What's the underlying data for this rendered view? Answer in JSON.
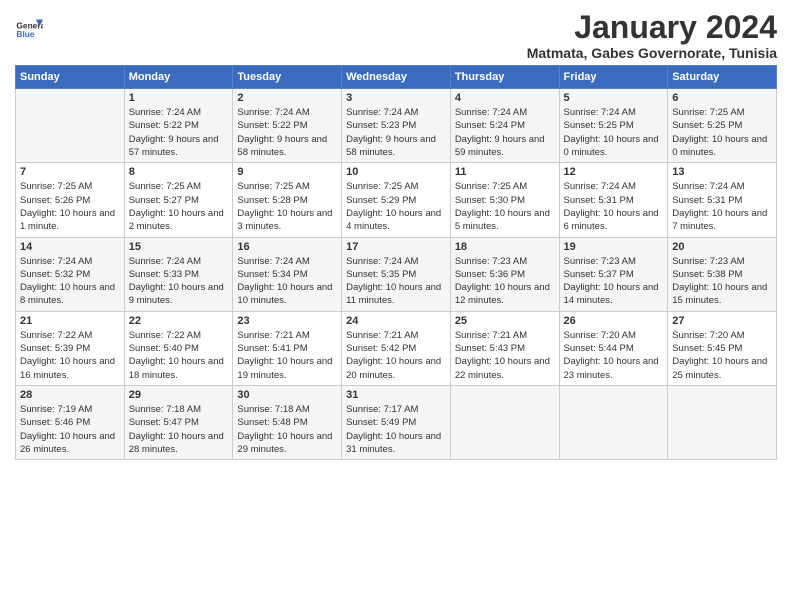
{
  "header": {
    "logo_general": "General",
    "logo_blue": "Blue",
    "title": "January 2024",
    "subtitle": "Matmata, Gabes Governorate, Tunisia"
  },
  "days_of_week": [
    "Sunday",
    "Monday",
    "Tuesday",
    "Wednesday",
    "Thursday",
    "Friday",
    "Saturday"
  ],
  "weeks": [
    [
      {
        "day": "",
        "sunrise": "",
        "sunset": "",
        "daylight": ""
      },
      {
        "day": "1",
        "sunrise": "Sunrise: 7:24 AM",
        "sunset": "Sunset: 5:22 PM",
        "daylight": "Daylight: 9 hours and 57 minutes."
      },
      {
        "day": "2",
        "sunrise": "Sunrise: 7:24 AM",
        "sunset": "Sunset: 5:22 PM",
        "daylight": "Daylight: 9 hours and 58 minutes."
      },
      {
        "day": "3",
        "sunrise": "Sunrise: 7:24 AM",
        "sunset": "Sunset: 5:23 PM",
        "daylight": "Daylight: 9 hours and 58 minutes."
      },
      {
        "day": "4",
        "sunrise": "Sunrise: 7:24 AM",
        "sunset": "Sunset: 5:24 PM",
        "daylight": "Daylight: 9 hours and 59 minutes."
      },
      {
        "day": "5",
        "sunrise": "Sunrise: 7:24 AM",
        "sunset": "Sunset: 5:25 PM",
        "daylight": "Daylight: 10 hours and 0 minutes."
      },
      {
        "day": "6",
        "sunrise": "Sunrise: 7:25 AM",
        "sunset": "Sunset: 5:25 PM",
        "daylight": "Daylight: 10 hours and 0 minutes."
      }
    ],
    [
      {
        "day": "7",
        "sunrise": "Sunrise: 7:25 AM",
        "sunset": "Sunset: 5:26 PM",
        "daylight": "Daylight: 10 hours and 1 minute."
      },
      {
        "day": "8",
        "sunrise": "Sunrise: 7:25 AM",
        "sunset": "Sunset: 5:27 PM",
        "daylight": "Daylight: 10 hours and 2 minutes."
      },
      {
        "day": "9",
        "sunrise": "Sunrise: 7:25 AM",
        "sunset": "Sunset: 5:28 PM",
        "daylight": "Daylight: 10 hours and 3 minutes."
      },
      {
        "day": "10",
        "sunrise": "Sunrise: 7:25 AM",
        "sunset": "Sunset: 5:29 PM",
        "daylight": "Daylight: 10 hours and 4 minutes."
      },
      {
        "day": "11",
        "sunrise": "Sunrise: 7:25 AM",
        "sunset": "Sunset: 5:30 PM",
        "daylight": "Daylight: 10 hours and 5 minutes."
      },
      {
        "day": "12",
        "sunrise": "Sunrise: 7:24 AM",
        "sunset": "Sunset: 5:31 PM",
        "daylight": "Daylight: 10 hours and 6 minutes."
      },
      {
        "day": "13",
        "sunrise": "Sunrise: 7:24 AM",
        "sunset": "Sunset: 5:31 PM",
        "daylight": "Daylight: 10 hours and 7 minutes."
      }
    ],
    [
      {
        "day": "14",
        "sunrise": "Sunrise: 7:24 AM",
        "sunset": "Sunset: 5:32 PM",
        "daylight": "Daylight: 10 hours and 8 minutes."
      },
      {
        "day": "15",
        "sunrise": "Sunrise: 7:24 AM",
        "sunset": "Sunset: 5:33 PM",
        "daylight": "Daylight: 10 hours and 9 minutes."
      },
      {
        "day": "16",
        "sunrise": "Sunrise: 7:24 AM",
        "sunset": "Sunset: 5:34 PM",
        "daylight": "Daylight: 10 hours and 10 minutes."
      },
      {
        "day": "17",
        "sunrise": "Sunrise: 7:24 AM",
        "sunset": "Sunset: 5:35 PM",
        "daylight": "Daylight: 10 hours and 11 minutes."
      },
      {
        "day": "18",
        "sunrise": "Sunrise: 7:23 AM",
        "sunset": "Sunset: 5:36 PM",
        "daylight": "Daylight: 10 hours and 12 minutes."
      },
      {
        "day": "19",
        "sunrise": "Sunrise: 7:23 AM",
        "sunset": "Sunset: 5:37 PM",
        "daylight": "Daylight: 10 hours and 14 minutes."
      },
      {
        "day": "20",
        "sunrise": "Sunrise: 7:23 AM",
        "sunset": "Sunset: 5:38 PM",
        "daylight": "Daylight: 10 hours and 15 minutes."
      }
    ],
    [
      {
        "day": "21",
        "sunrise": "Sunrise: 7:22 AM",
        "sunset": "Sunset: 5:39 PM",
        "daylight": "Daylight: 10 hours and 16 minutes."
      },
      {
        "day": "22",
        "sunrise": "Sunrise: 7:22 AM",
        "sunset": "Sunset: 5:40 PM",
        "daylight": "Daylight: 10 hours and 18 minutes."
      },
      {
        "day": "23",
        "sunrise": "Sunrise: 7:21 AM",
        "sunset": "Sunset: 5:41 PM",
        "daylight": "Daylight: 10 hours and 19 minutes."
      },
      {
        "day": "24",
        "sunrise": "Sunrise: 7:21 AM",
        "sunset": "Sunset: 5:42 PM",
        "daylight": "Daylight: 10 hours and 20 minutes."
      },
      {
        "day": "25",
        "sunrise": "Sunrise: 7:21 AM",
        "sunset": "Sunset: 5:43 PM",
        "daylight": "Daylight: 10 hours and 22 minutes."
      },
      {
        "day": "26",
        "sunrise": "Sunrise: 7:20 AM",
        "sunset": "Sunset: 5:44 PM",
        "daylight": "Daylight: 10 hours and 23 minutes."
      },
      {
        "day": "27",
        "sunrise": "Sunrise: 7:20 AM",
        "sunset": "Sunset: 5:45 PM",
        "daylight": "Daylight: 10 hours and 25 minutes."
      }
    ],
    [
      {
        "day": "28",
        "sunrise": "Sunrise: 7:19 AM",
        "sunset": "Sunset: 5:46 PM",
        "daylight": "Daylight: 10 hours and 26 minutes."
      },
      {
        "day": "29",
        "sunrise": "Sunrise: 7:18 AM",
        "sunset": "Sunset: 5:47 PM",
        "daylight": "Daylight: 10 hours and 28 minutes."
      },
      {
        "day": "30",
        "sunrise": "Sunrise: 7:18 AM",
        "sunset": "Sunset: 5:48 PM",
        "daylight": "Daylight: 10 hours and 29 minutes."
      },
      {
        "day": "31",
        "sunrise": "Sunrise: 7:17 AM",
        "sunset": "Sunset: 5:49 PM",
        "daylight": "Daylight: 10 hours and 31 minutes."
      },
      {
        "day": "",
        "sunrise": "",
        "sunset": "",
        "daylight": ""
      },
      {
        "day": "",
        "sunrise": "",
        "sunset": "",
        "daylight": ""
      },
      {
        "day": "",
        "sunrise": "",
        "sunset": "",
        "daylight": ""
      }
    ]
  ]
}
